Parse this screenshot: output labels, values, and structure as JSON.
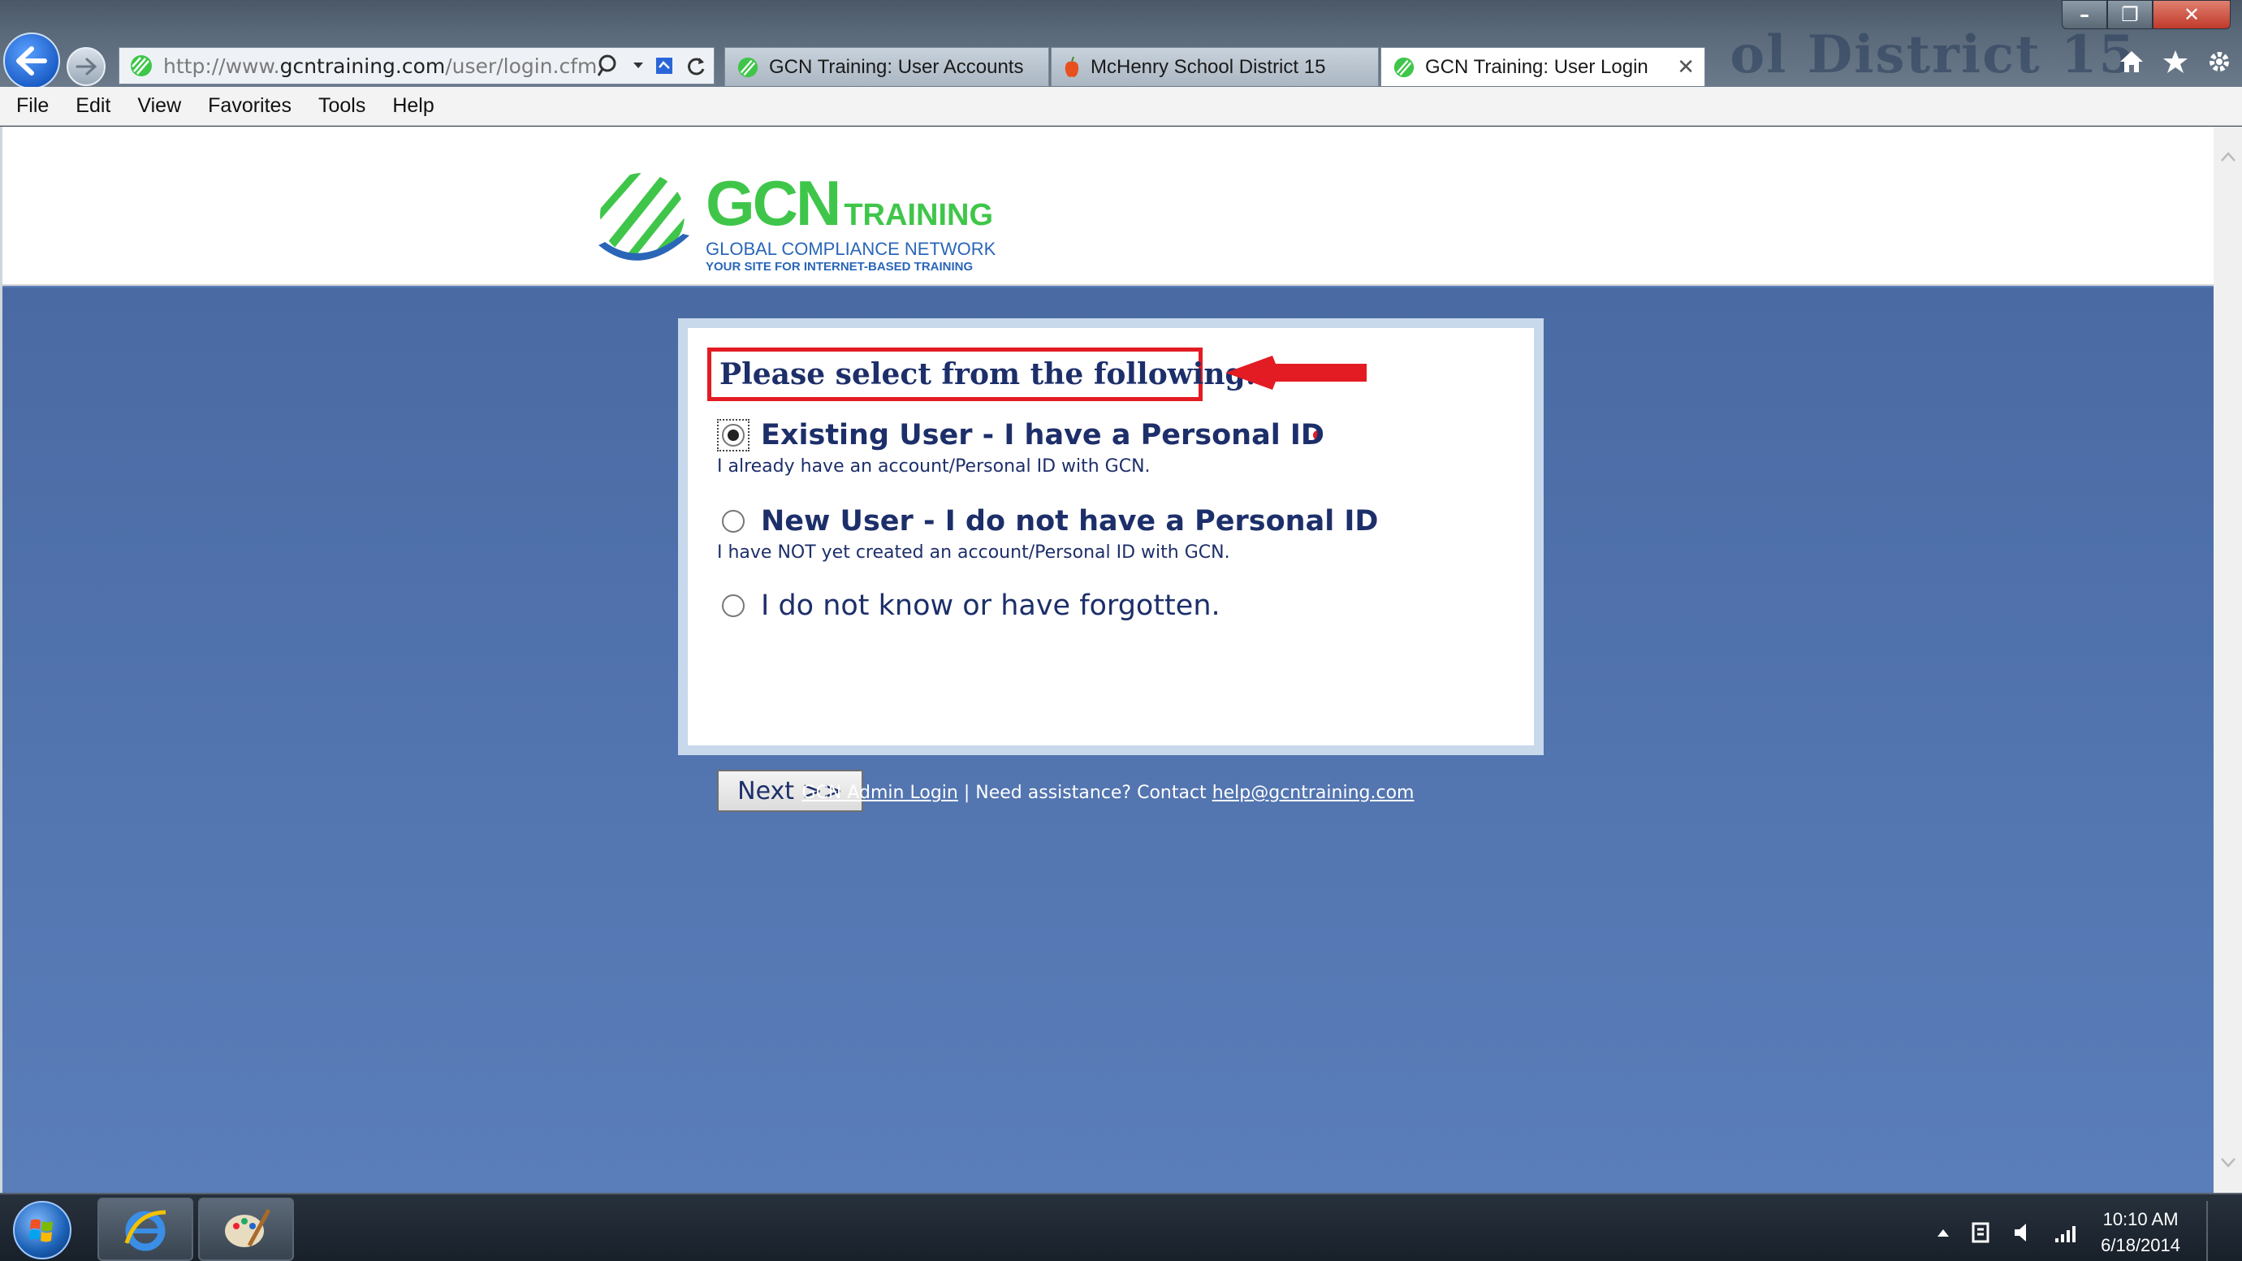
{
  "browser": {
    "url_prefix": "http://www.",
    "url_domain": "gcntraining.com",
    "url_path": "/user/login.cfm",
    "watermark": "ol District 15",
    "tabs": [
      {
        "label": "GCN Training: User Accounts",
        "icon": "gcn-favicon"
      },
      {
        "label": "McHenry School District 15",
        "icon": "apple-favicon"
      },
      {
        "label": "GCN Training: User Login",
        "icon": "gcn-favicon",
        "active": true
      }
    ],
    "menu": [
      "File",
      "Edit",
      "View",
      "Favorites",
      "Tools",
      "Help"
    ]
  },
  "logo": {
    "name": "GCN",
    "name_suffix": "TRAINING",
    "subtitle": "GLOBAL COMPLIANCE NETWORK",
    "tagline": "YOUR SITE FOR INTERNET-BASED TRAINING"
  },
  "login": {
    "heading": "Please select from the following:",
    "options": [
      {
        "label": "Existing User - I have a Personal ID",
        "description": "I already have an account/Personal ID with GCN.",
        "checked": true
      },
      {
        "label": "New User - I do not have a Personal ID",
        "description": "I have NOT yet created an account/Personal ID with GCN.",
        "checked": false
      },
      {
        "label": "I do not know or have forgotten.",
        "description": "",
        "checked": false
      }
    ],
    "next_label": "Next >>"
  },
  "footer": {
    "admin_link": "GCN Admin Login",
    "separator": "|",
    "assist_text": "Need assistance? Contact",
    "email_link": "help@gcntraining.com"
  },
  "taskbar": {
    "time": "10:10 AM",
    "date": "6/18/2014"
  },
  "colors": {
    "page_bg": "#5b7fba",
    "heading": "#1d2f6a",
    "highlight": "#e31b23",
    "brand_green": "#3fc64a",
    "brand_blue": "#2a66b8"
  }
}
